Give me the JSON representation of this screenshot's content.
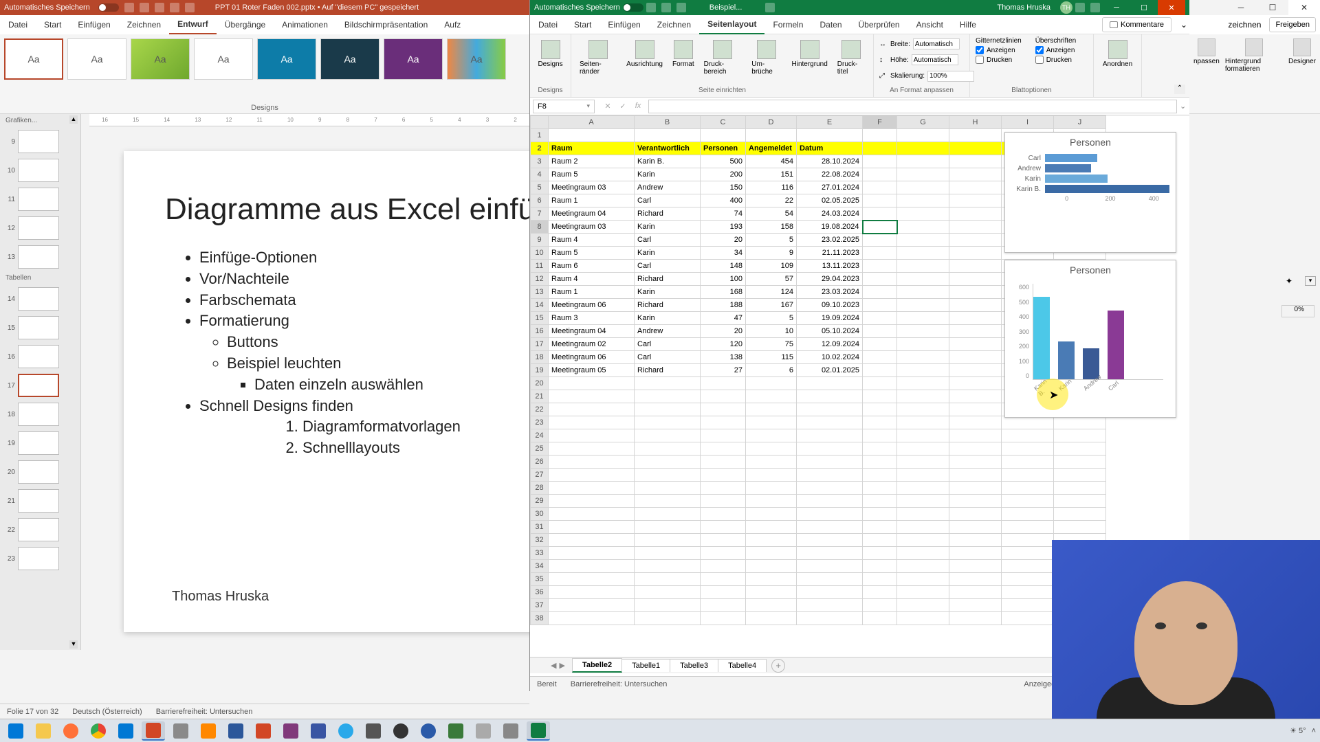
{
  "powerpoint": {
    "titlebar": {
      "autosave": "Automatisches Speichern",
      "filename": "PPT 01 Roter Faden 002.pptx",
      "saved_location": "• Auf \"diesem PC\" gespeichert"
    },
    "tabs": [
      "Datei",
      "Start",
      "Einfügen",
      "Zeichnen",
      "Entwurf",
      "Übergänge",
      "Animationen",
      "Bildschirmpräsentation",
      "Aufz"
    ],
    "active_tab": "Entwurf",
    "right_tabs": [
      "zeichnen",
      "Freigeben"
    ],
    "ribbon": {
      "designs_label": "Designs",
      "rhs_labels": {
        "anpassen": "npassen",
        "hintergrund": "Hintergrund formatieren",
        "designer": "Designer"
      }
    },
    "slide": {
      "title": "Diagramme aus Excel einfü",
      "bullets": [
        "Einfüge-Optionen",
        "Vor/Nachteile",
        "Farbschemata",
        "Formatierung"
      ],
      "sub_bullets": [
        "Buttons",
        "Beispiel leuchten"
      ],
      "subsub_bullets": [
        "Daten einzeln auswählen"
      ],
      "bullet5": "Schnell Designs finden",
      "ol": [
        "Diagramformatvorlagen",
        "Schnelllayouts"
      ],
      "author": "Thomas Hruska"
    },
    "thumbs": {
      "group1_label": "Grafiken...",
      "group2_label": "Tabellen",
      "numbers": [
        "9",
        "10",
        "11",
        "12",
        "13",
        "14",
        "15",
        "16",
        "17",
        "18",
        "19",
        "20",
        "21",
        "22",
        "23"
      ]
    },
    "status": {
      "slide_count": "Folie 17 von 32",
      "language": "Deutsch (Österreich)",
      "accessibility": "Barrierefreiheit: Untersuchen"
    },
    "side_panel": {
      "zoom": "0%"
    }
  },
  "excel": {
    "titlebar": {
      "autosave": "Automatisches Speichern",
      "filename": "Beispiel...",
      "user": "Thomas Hruska",
      "badge": "TH"
    },
    "tabs": [
      "Datei",
      "Start",
      "Einfügen",
      "Zeichnen",
      "Seitenlayout",
      "Formeln",
      "Daten",
      "Überprüfen",
      "Ansicht",
      "Hilfe"
    ],
    "active_tab": "Seitenlayout",
    "comments_button": "Kommentare",
    "ribbon": {
      "designs": "Designs",
      "seiten_group": {
        "seitenraender": "Seiten-ränder",
        "ausrichtung": "Ausrichtung",
        "format": "Format",
        "druckbereich": "Druck-bereich",
        "umbrueche": "Um-brüche",
        "hintergrund": "Hintergrund",
        "drucktitel": "Druck-titel",
        "label": "Seite einrichten"
      },
      "format_group": {
        "breite": "Breite:",
        "breite_val": "Automatisch",
        "hoehe": "Höhe:",
        "hoehe_val": "Automatisch",
        "skalierung": "Skalierung:",
        "skalierung_val": "100%",
        "label": "An Format anpassen"
      },
      "blatt_group": {
        "gitter": "Gitternetzlinien",
        "ueberschriften": "Überschriften",
        "anzeigen": "Anzeigen",
        "drucken": "Drucken",
        "label": "Blattoptionen"
      },
      "anordnen_group": {
        "anordnen": "Anordnen"
      }
    },
    "namebox": "F8",
    "columns": [
      "A",
      "B",
      "C",
      "D",
      "E",
      "F",
      "G",
      "H",
      "I",
      "J"
    ],
    "header_row": [
      "Raum",
      "Verantwortlich",
      "Personen",
      "Angemeldet",
      "Datum"
    ],
    "data_rows": [
      {
        "r": "3",
        "a": "Raum 2",
        "b": "Karin B.",
        "c": "500",
        "d": "454",
        "e": "28.10.2024"
      },
      {
        "r": "4",
        "a": "Raum 5",
        "b": "Karin",
        "c": "200",
        "d": "151",
        "e": "22.08.2024"
      },
      {
        "r": "5",
        "a": "Meetingraum 03",
        "b": "Andrew",
        "c": "150",
        "d": "116",
        "e": "27.01.2024"
      },
      {
        "r": "6",
        "a": "Raum 1",
        "b": "Carl",
        "c": "400",
        "d": "22",
        "e": "02.05.2025"
      },
      {
        "r": "7",
        "a": "Meetingraum 04",
        "b": "Richard",
        "c": "74",
        "d": "54",
        "e": "24.03.2024"
      },
      {
        "r": "8",
        "a": "Meetingraum 03",
        "b": "Karin",
        "c": "193",
        "d": "158",
        "e": "19.08.2024"
      },
      {
        "r": "9",
        "a": "Raum 4",
        "b": "Carl",
        "c": "20",
        "d": "5",
        "e": "23.02.2025"
      },
      {
        "r": "10",
        "a": "Raum 5",
        "b": "Karin",
        "c": "34",
        "d": "9",
        "e": "21.11.2023"
      },
      {
        "r": "11",
        "a": "Raum 6",
        "b": "Carl",
        "c": "148",
        "d": "109",
        "e": "13.11.2023"
      },
      {
        "r": "12",
        "a": "Raum 4",
        "b": "Richard",
        "c": "100",
        "d": "57",
        "e": "29.04.2023"
      },
      {
        "r": "13",
        "a": "Raum 1",
        "b": "Karin",
        "c": "168",
        "d": "124",
        "e": "23.03.2024"
      },
      {
        "r": "14",
        "a": "Meetingraum 06",
        "b": "Richard",
        "c": "188",
        "d": "167",
        "e": "09.10.2023"
      },
      {
        "r": "15",
        "a": "Raum 3",
        "b": "Karin",
        "c": "47",
        "d": "5",
        "e": "19.09.2024"
      },
      {
        "r": "16",
        "a": "Meetingraum 04",
        "b": "Andrew",
        "c": "20",
        "d": "10",
        "e": "05.10.2024"
      },
      {
        "r": "17",
        "a": "Meetingraum 02",
        "b": "Carl",
        "c": "120",
        "d": "75",
        "e": "12.09.2024"
      },
      {
        "r": "18",
        "a": "Meetingraum 06",
        "b": "Carl",
        "c": "138",
        "d": "115",
        "e": "10.02.2024"
      },
      {
        "r": "19",
        "a": "Meetingraum 05",
        "b": "Richard",
        "c": "27",
        "d": "6",
        "e": "02.01.2025"
      }
    ],
    "empty_rows": [
      "20",
      "21",
      "22",
      "23",
      "24",
      "25",
      "26",
      "27",
      "28",
      "29",
      "30",
      "31",
      "32",
      "33",
      "34",
      "35",
      "36",
      "37",
      "38"
    ],
    "selected_row": "8",
    "selected_col": "F",
    "chart1": {
      "title": "Personen",
      "bars": [
        {
          "label": "Carl",
          "w": 40
        },
        {
          "label": "Andrew",
          "w": 35
        },
        {
          "label": "Karin",
          "w": 48
        },
        {
          "label": "Karin B.",
          "w": 95
        }
      ],
      "axis": [
        "0",
        "200",
        "400"
      ]
    },
    "chart2": {
      "title": "Personen",
      "yticks": [
        "600",
        "500",
        "400",
        "300",
        "200",
        "100",
        "0"
      ],
      "xlabels": [
        "Karin B.",
        "Karin",
        "Andrew",
        "Carl"
      ]
    },
    "sheets": [
      "Tabelle2",
      "Tabelle1",
      "Tabelle3",
      "Tabelle4"
    ],
    "active_sheet": "Tabelle2",
    "status": {
      "ready": "Bereit",
      "accessibility": "Barrierefreiheit: Untersuchen",
      "display": "Anzeigeeinstellungen"
    }
  },
  "taskbar": {
    "weather": "5°",
    "icons": [
      "windows",
      "explorer",
      "firefox",
      "chrome",
      "outlook",
      "powerpoint",
      "snip",
      "vlc",
      "word",
      "onenote",
      "onenote2",
      "visio",
      "telegram",
      "app1",
      "app2",
      "app3",
      "app4",
      "app5",
      "app6",
      "excel"
    ]
  },
  "chart_data": [
    {
      "type": "bar",
      "orientation": "horizontal",
      "title": "Personen",
      "categories": [
        "Carl",
        "Andrew",
        "Karin",
        "Karin B."
      ],
      "values": [
        210,
        180,
        250,
        500
      ],
      "xlim": [
        0,
        500
      ],
      "xticks": [
        0,
        200,
        400
      ]
    },
    {
      "type": "bar",
      "orientation": "vertical",
      "title": "Personen",
      "categories": [
        "Karin B.",
        "Karin",
        "Andrew",
        "Carl"
      ],
      "values": [
        500,
        230,
        190,
        420
      ],
      "ylim": [
        0,
        600
      ],
      "yticks": [
        0,
        100,
        200,
        300,
        400,
        500,
        600
      ]
    }
  ]
}
